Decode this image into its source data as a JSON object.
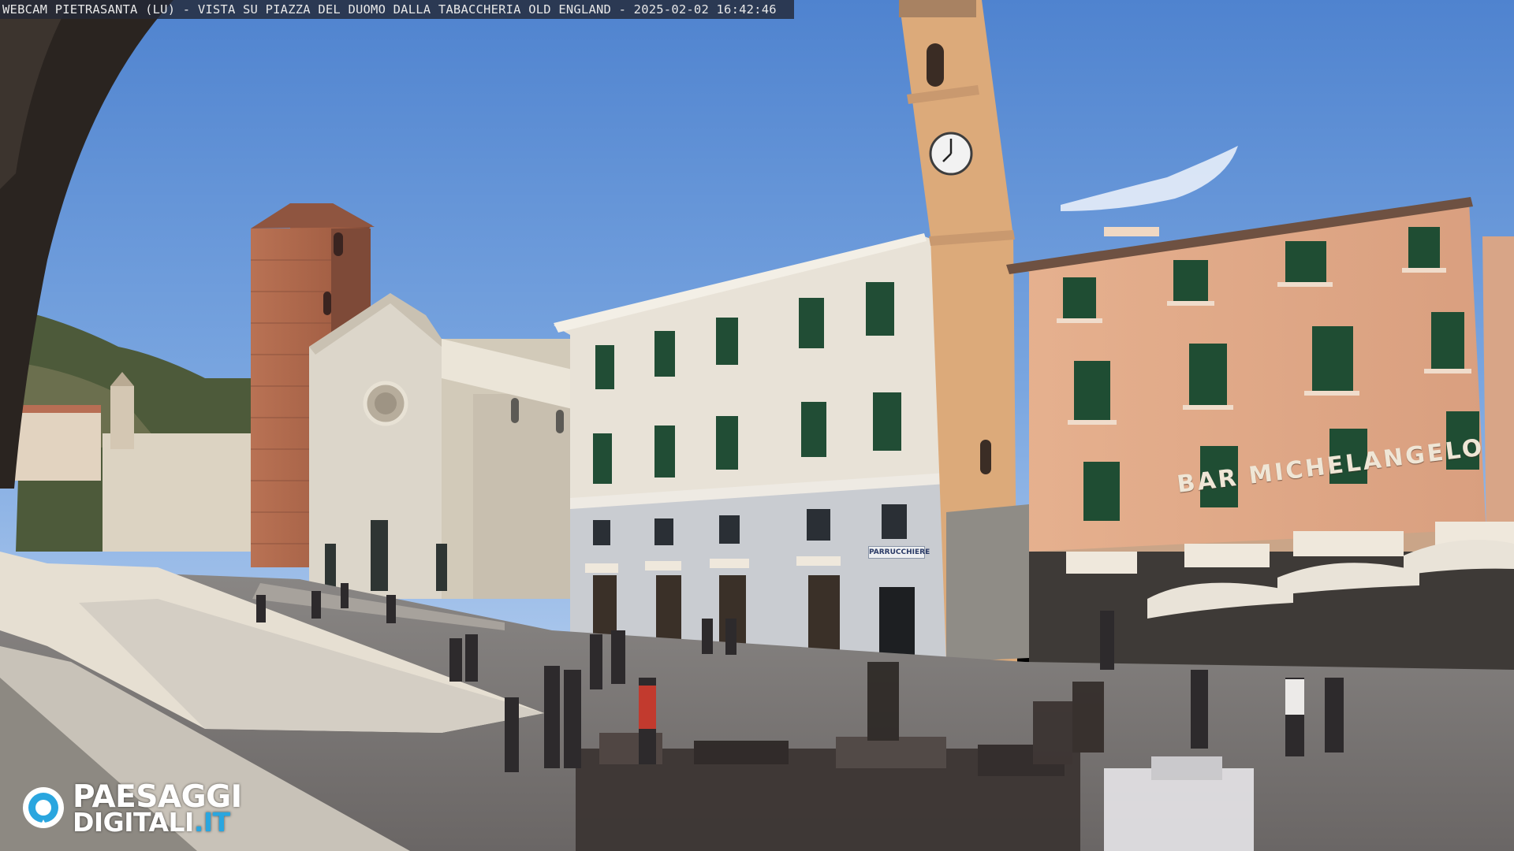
{
  "overlay": {
    "caption": "WEBCAM PIETRASANTA (LU) - VISTA SU PIAZZA DEL DUOMO DALLA TABACCHERIA OLD ENGLAND - 2025-02-02 16:42:46"
  },
  "signs": {
    "bar": "BAR MICHELANGELO",
    "shop": "PARRUCCHIERE"
  },
  "logo": {
    "line1": "PAESAGGI",
    "line2_main": "DIGITALI",
    "line2_accent": ".IT",
    "accent_color": "#2aa6df"
  },
  "scene": {
    "sky_color": "#5f8fd2",
    "cathedral_color": "#d9d3c6",
    "bell_tower_color": "#a9684c",
    "white_palace_color": "#e7e1d6",
    "pink_palace_color": "#e3ad8b",
    "clock_tower_color": "#d9ab7f",
    "shutter_color": "#1f5a3a",
    "umbrella_color": "#e9e2d6"
  }
}
